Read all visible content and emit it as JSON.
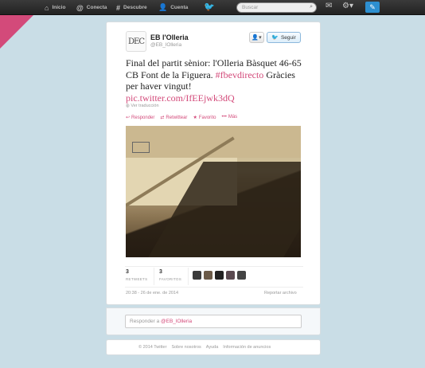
{
  "nav": {
    "home": "Inicio",
    "connect": "Conecta",
    "discover": "Descubre",
    "account": "Cuenta"
  },
  "search": {
    "placeholder": "Buscar"
  },
  "tweet": {
    "name": "EB l'Olleria",
    "handle": "@EB_lOlleria",
    "follow_label": "Seguir",
    "text_main": "Final del partit sènior: l'Olleria Bàsquet 46-65 CB Font de la Figuera. ",
    "hashtag": "#fbevdirecto",
    "text_thanks": " Gràcies per haver vingut!",
    "pic_link": "pic.twitter.com/IfEEjwk3dQ",
    "translate_label": "Ver traducción",
    "actions": {
      "reply": "Responder",
      "retweet": "Retwittear",
      "favorite": "Favorito",
      "more": "Más"
    },
    "retweets_count": "3",
    "retweets_label": "RETWEETS",
    "favorites_count": "3",
    "favorites_label": "FAVORITOS",
    "timestamp": "20:38 - 26 de ene. de 2014",
    "report_label": "Reportar archivo"
  },
  "reply": {
    "prefix": "Responder a ",
    "mention": "@EB_lOlleria"
  },
  "footer": {
    "copyright": "© 2014 Twitter",
    "about": "Sobre nosotros",
    "help": "Ayuda",
    "ads": "Información de anuncios"
  },
  "colors": {
    "accent": "#d34a7a",
    "topbar": "#2b2b2b",
    "background": "#c9dde6",
    "compose": "#2d8fd0"
  }
}
